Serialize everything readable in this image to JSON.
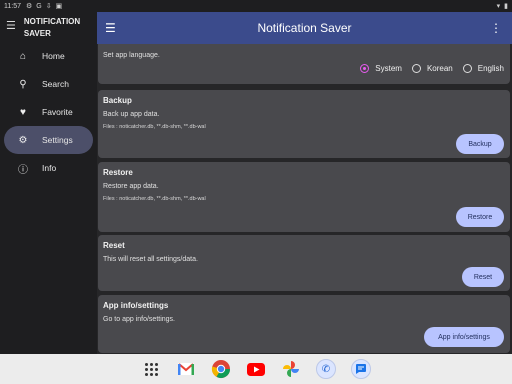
{
  "status_bar": {
    "time": "11:57",
    "icons": [
      "settings-icon",
      "google-icon",
      "download-icon",
      "calendar-icon"
    ],
    "right_icons": [
      "wifi-icon",
      "battery-icon"
    ]
  },
  "sidebar": {
    "title_line1": "NOTIFICATION",
    "title_line2": "SAVER",
    "items": [
      {
        "label": "Home",
        "icon": "home-icon"
      },
      {
        "label": "Search",
        "icon": "search-icon"
      },
      {
        "label": "Favorite",
        "icon": "heart-icon"
      },
      {
        "label": "Settings",
        "icon": "gear-icon"
      },
      {
        "label": "Info",
        "icon": "info-icon"
      }
    ]
  },
  "appbar": {
    "title": "Notification Saver"
  },
  "language": {
    "desc": "Set app language.",
    "options": [
      "System",
      "Korean",
      "English"
    ],
    "selected": "System"
  },
  "backup": {
    "title": "Backup",
    "desc": "Back up app data.",
    "files": "Files : noticatcher.db, **.db-shm, **.db-wal",
    "button": "Backup"
  },
  "restore": {
    "title": "Restore",
    "desc": "Restore app data.",
    "files": "Files : noticatcher.db, **.db-shm, **.db-wal",
    "button": "Restore"
  },
  "reset": {
    "title": "Reset",
    "desc": "This will reset all settings/data.",
    "button": "Reset"
  },
  "appinfo": {
    "title": "App info/settings",
    "desc": "Go to app info/settings.",
    "button": "App info/settings"
  },
  "taskbar": {
    "apps": [
      "app-drawer-icon",
      "gmail-icon",
      "chrome-icon",
      "youtube-icon",
      "photos-icon",
      "phone-icon",
      "messages-icon"
    ]
  }
}
